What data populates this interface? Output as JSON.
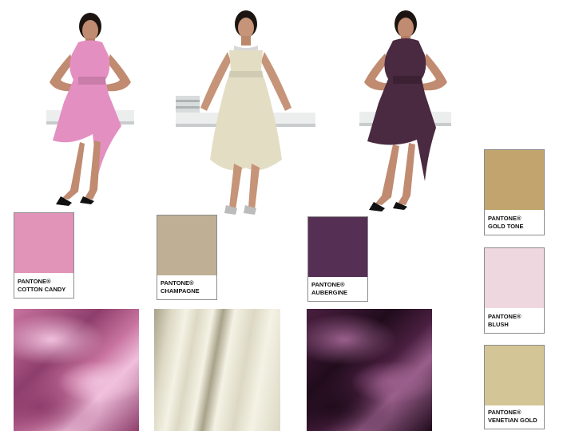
{
  "dresses": [
    {
      "color": "#e48fc1",
      "name": "pink-dress"
    },
    {
      "color": "#e3ddc4",
      "name": "champagne-dress"
    },
    {
      "color": "#4a2a40",
      "name": "aubergine-dress"
    }
  ],
  "swatches": [
    {
      "brand": "PANTONE®",
      "name": "COTTON CANDY",
      "color": "#e193b8"
    },
    {
      "brand": "PANTONE®",
      "name": "CHAMPAGNE",
      "color": "#bfb095"
    },
    {
      "brand": "PANTONE®",
      "name": "AUBERGINE",
      "color": "#562f55"
    },
    {
      "brand": "PANTONE®",
      "name": "GOLD TONE",
      "color": "#c2a46e"
    },
    {
      "brand": "PANTONE®",
      "name": "BLUSH",
      "color": "#efd7df"
    },
    {
      "brand": "PANTONE®",
      "name": "VENETIAN GOLD",
      "color": "#d4c596"
    }
  ],
  "fabrics": [
    {
      "name": "pink-satin",
      "base": "#c8739f",
      "light": "#f0c0dc",
      "dark": "#8e3e6c"
    },
    {
      "name": "champagne-silk",
      "base": "#dcd8c4",
      "light": "#f4f2e4",
      "dark": "#a8a28a"
    },
    {
      "name": "aubergine-satin",
      "base": "#4a1f40",
      "light": "#9a5f8c",
      "dark": "#200c1c"
    }
  ]
}
